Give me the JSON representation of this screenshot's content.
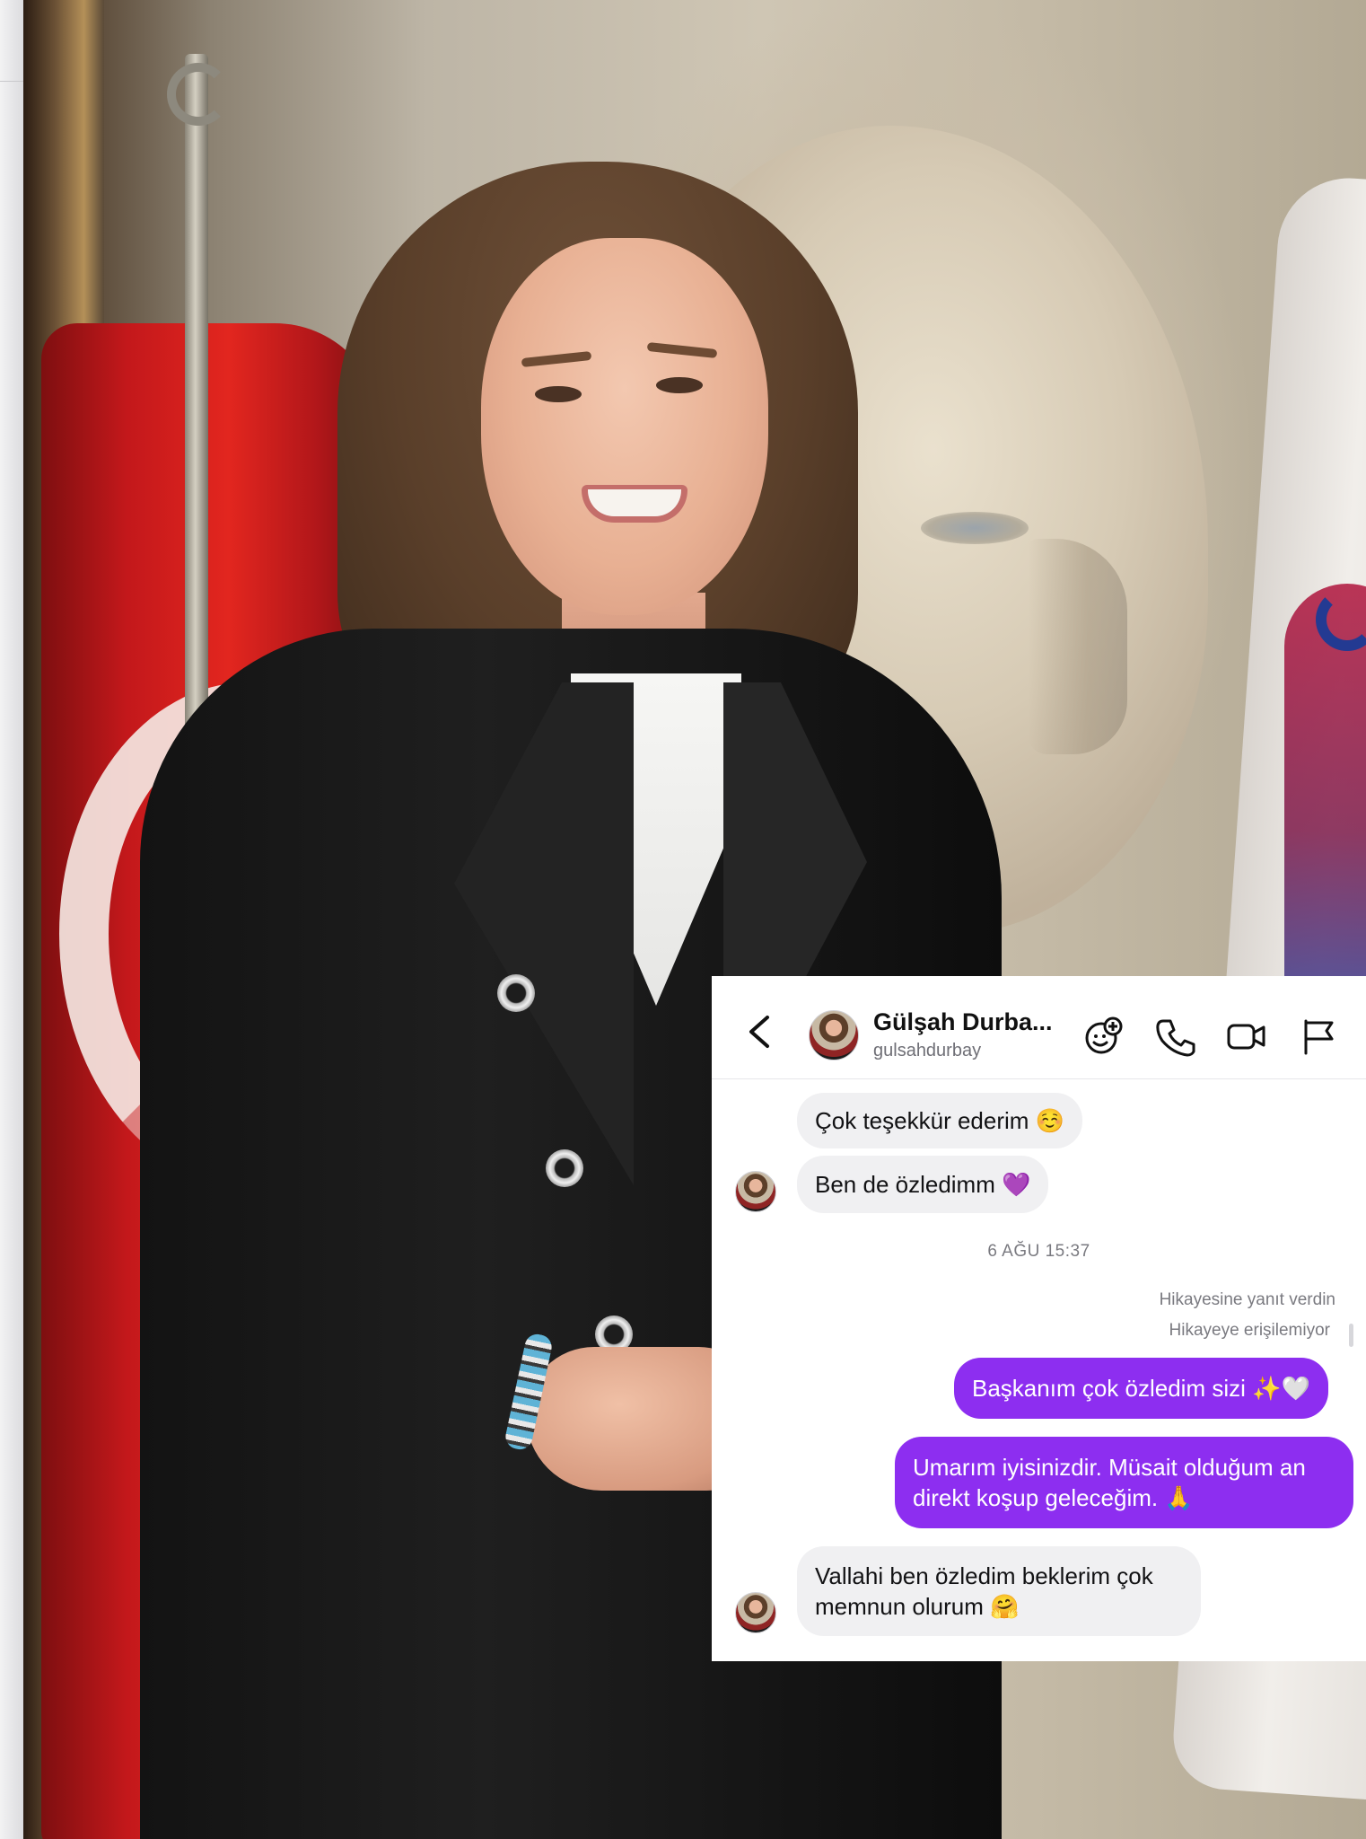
{
  "chat": {
    "header": {
      "name": "Gülşah Durba...",
      "username": "gulsahdurbay",
      "icons": [
        "back-icon",
        "add-sticker-icon",
        "phone-icon",
        "video-icon",
        "flag-icon"
      ]
    },
    "messages": [
      {
        "from": "them",
        "text": "Çok teşekkür ederim ☺️"
      },
      {
        "from": "them",
        "text": "Ben de özledimm 💜"
      },
      {
        "type": "timestamp",
        "text": "6 AĞU 15:37"
      },
      {
        "type": "note",
        "text": "Hikayesine yanıt verdin"
      },
      {
        "type": "note",
        "text": "Hikayeye erişilemiyor"
      },
      {
        "from": "me",
        "text": "Başkanım çok özledim sizi ✨🤍"
      },
      {
        "from": "me",
        "line1": "Umarım iyisinizdir. Müsait olduğum an",
        "line2": "direkt koşup geleceğim. 🙏"
      },
      {
        "from": "them",
        "line1": "Vallahi ben özledim beklerim çok",
        "line2": "memnun olurum 🤗"
      }
    ],
    "colors": {
      "outgoing": "#8d2ef0",
      "incoming": "#f0f0f2",
      "muted": "#7a7a80"
    }
  }
}
